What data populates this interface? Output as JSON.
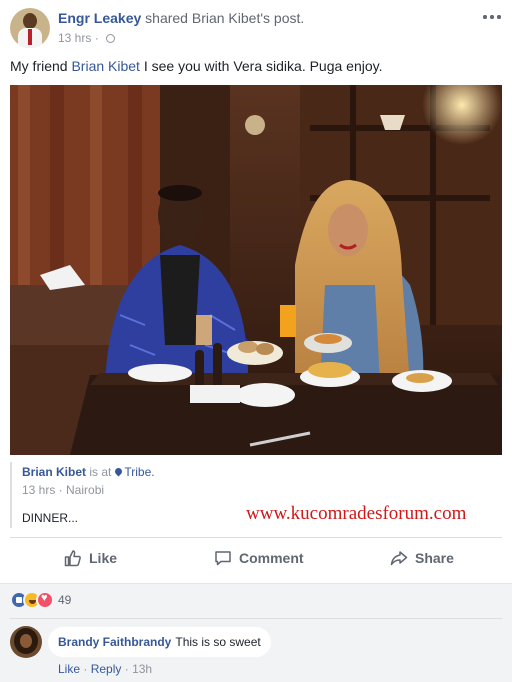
{
  "post": {
    "author": "Engr Leakey",
    "shared_text": "shared",
    "shared_target": "Brian Kibet's post.",
    "time": "13 hrs",
    "text_prefix": "My friend",
    "text_link": "Brian Kibet",
    "text_suffix": "I see you with Vera sidika. Puga enjoy."
  },
  "shared_post": {
    "author": "Brian Kibet",
    "is_at": "is at",
    "place": "Tribe.",
    "meta": "13 hrs · Nairobi",
    "caption": "DINNER..."
  },
  "watermark": "www.kucomradesforum.com",
  "actions": {
    "like": "Like",
    "comment": "Comment",
    "share": "Share"
  },
  "reactions": {
    "types": [
      "like",
      "haha",
      "love"
    ],
    "count": "49"
  },
  "comment": {
    "author": "Brandy Faithbrandy",
    "text": "This is so sweet",
    "like_label": "Like",
    "reply_label": "Reply",
    "time": "13h",
    "separator": "·"
  },
  "colors": {
    "link": "#365899",
    "meta": "#90949c",
    "action": "#606770",
    "watermark": "#d01818"
  }
}
